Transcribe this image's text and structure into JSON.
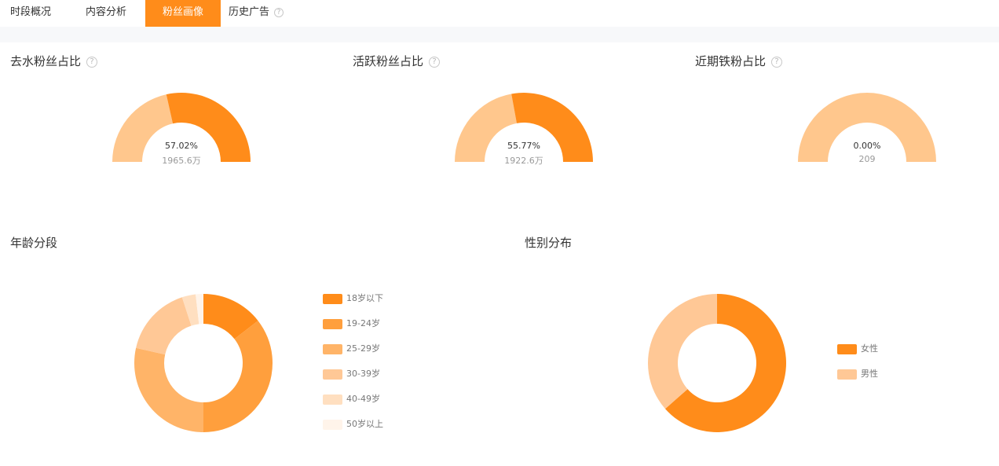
{
  "tabs": [
    {
      "label": "时段概况",
      "active": false
    },
    {
      "label": "内容分析",
      "active": false
    },
    {
      "label": "粉丝画像",
      "active": true
    },
    {
      "label": "历史广告",
      "active": false,
      "help": "?"
    }
  ],
  "colors": {
    "accent": "#ff8c1a",
    "light": "#ffc78d",
    "age": [
      "#ff8c1a",
      "#ff9f3d",
      "#ffb468",
      "#ffc896",
      "#ffdfc0",
      "#fff4ea"
    ],
    "gender": [
      "#ff8c1a",
      "#ffc896"
    ]
  },
  "chart_data": [
    {
      "type": "pie",
      "variant": "half-donut",
      "title": "去水粉丝占比",
      "help": "?",
      "value_label": "57.02%",
      "sub_label": "1965.6万",
      "series": [
        {
          "value": 57.02
        },
        {
          "value": 42.98
        }
      ]
    },
    {
      "type": "pie",
      "variant": "half-donut",
      "title": "活跃粉丝占比",
      "help": "?",
      "value_label": "55.77%",
      "sub_label": "1922.6万",
      "series": [
        {
          "value": 55.77
        },
        {
          "value": 44.23
        }
      ]
    },
    {
      "type": "pie",
      "variant": "half-donut",
      "title": "近期铁粉占比",
      "help": "?",
      "value_label": "0.00%",
      "sub_label": "209",
      "series": [
        {
          "value": 0.0
        },
        {
          "value": 100.0
        }
      ]
    },
    {
      "type": "pie",
      "variant": "donut",
      "title": "年龄分段",
      "legend": "right",
      "categories": [
        "18岁以下",
        "19-24岁",
        "25-29岁",
        "30-39岁",
        "40-49岁",
        "50岁以上"
      ],
      "values": [
        14.5,
        35.5,
        28.5,
        16.5,
        3.2,
        1.8
      ]
    },
    {
      "type": "pie",
      "variant": "donut",
      "title": "性别分布",
      "legend": "right",
      "categories": [
        "女性",
        "男性"
      ],
      "values": [
        63.5,
        36.5
      ]
    }
  ]
}
